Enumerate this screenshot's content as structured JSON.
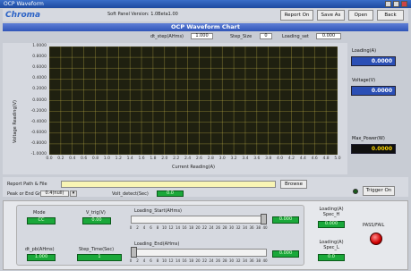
{
  "window": {
    "title": "OCP Waveform"
  },
  "toolbar": {
    "logo": "Chroma",
    "version": "Soft Panel Version: 1.0Beta1.00",
    "buttons": [
      "Report On",
      "Save As",
      "Open",
      "Back"
    ]
  },
  "chart_title": "OCP Waveform Chart",
  "params": {
    "dt_label": "dt_step(AHms)",
    "dt_value": "1.000",
    "step_label": "Step_Size",
    "step_value": "0",
    "loading_label": "Loading_set",
    "loading_value": "0.000"
  },
  "chart_data": {
    "type": "line",
    "title": "",
    "xlabel": "Current Reading(A)",
    "ylabel": "Voltage Reading(V)",
    "xlim": [
      0.0,
      5.0
    ],
    "ylim": [
      -1.0,
      1.0
    ],
    "x_ticks": [
      "0.0",
      "0.2",
      "0.4",
      "0.6",
      "0.8",
      "1.0",
      "1.2",
      "1.4",
      "1.6",
      "1.8",
      "2.0",
      "2.2",
      "2.4",
      "2.6",
      "2.8",
      "3.0",
      "3.2",
      "3.4",
      "3.6",
      "3.8",
      "4.0",
      "4.2",
      "4.4",
      "4.6",
      "4.8",
      "5.0"
    ],
    "y_ticks": [
      "1.0000",
      "0.8000",
      "0.6000",
      "0.4000",
      "0.2000",
      "0.0000",
      "-0.2000",
      "-0.4000",
      "-0.6000",
      "-0.8000",
      "-1.0000"
    ],
    "grid": true,
    "series": []
  },
  "readouts": {
    "loading_label": "Loading(A)",
    "loading_value": "0.0000",
    "voltage_label": "Voltage(V)",
    "voltage_value": "0.0000",
    "max_label": "Max_Power(W)",
    "max_value": "0.0000"
  },
  "path": {
    "label": "Report Path & File",
    "browse": "Browse",
    "trig_label": "Peak or End Gm",
    "trig_value": "0.4(null)",
    "volt_label": "Volt_detect(Sec)",
    "volt_value": "0.0",
    "trigger_button": "Trigger On"
  },
  "controls": {
    "mode_label": "Mode",
    "mode_value": "CC",
    "vtrig_label": "V_trig(V)",
    "vtrig_value": "0.00",
    "start_label": "Loading_Start(AHms)",
    "start_value": "0.000",
    "ends_label": "Loading(A) Spec_H",
    "ends_value": "0.000",
    "step_label": "dt_pb(AHms)",
    "step_value": "1.000",
    "steptime_label": "Step_Time(Sec)",
    "steptime_value": "1",
    "end_label": "Loading_End(AHms)",
    "end_value": "0.000",
    "specl_label": "Loading(A) Spec_L",
    "specl_value": "0.0",
    "status_label": "PASS/FAIL"
  },
  "slider_ticks": [
    "0",
    "2",
    "4",
    "6",
    "8",
    "10",
    "12",
    "14",
    "16",
    "18",
    "20",
    "22",
    "24",
    "26",
    "28",
    "30",
    "32",
    "34",
    "36",
    "38",
    "40"
  ],
  "colors": {
    "plot_bg": "#1f2010",
    "grid": "#c8b84a",
    "title_bar": "#2f55b8",
    "led": "#d00000",
    "green_field": "#1aa83a"
  }
}
